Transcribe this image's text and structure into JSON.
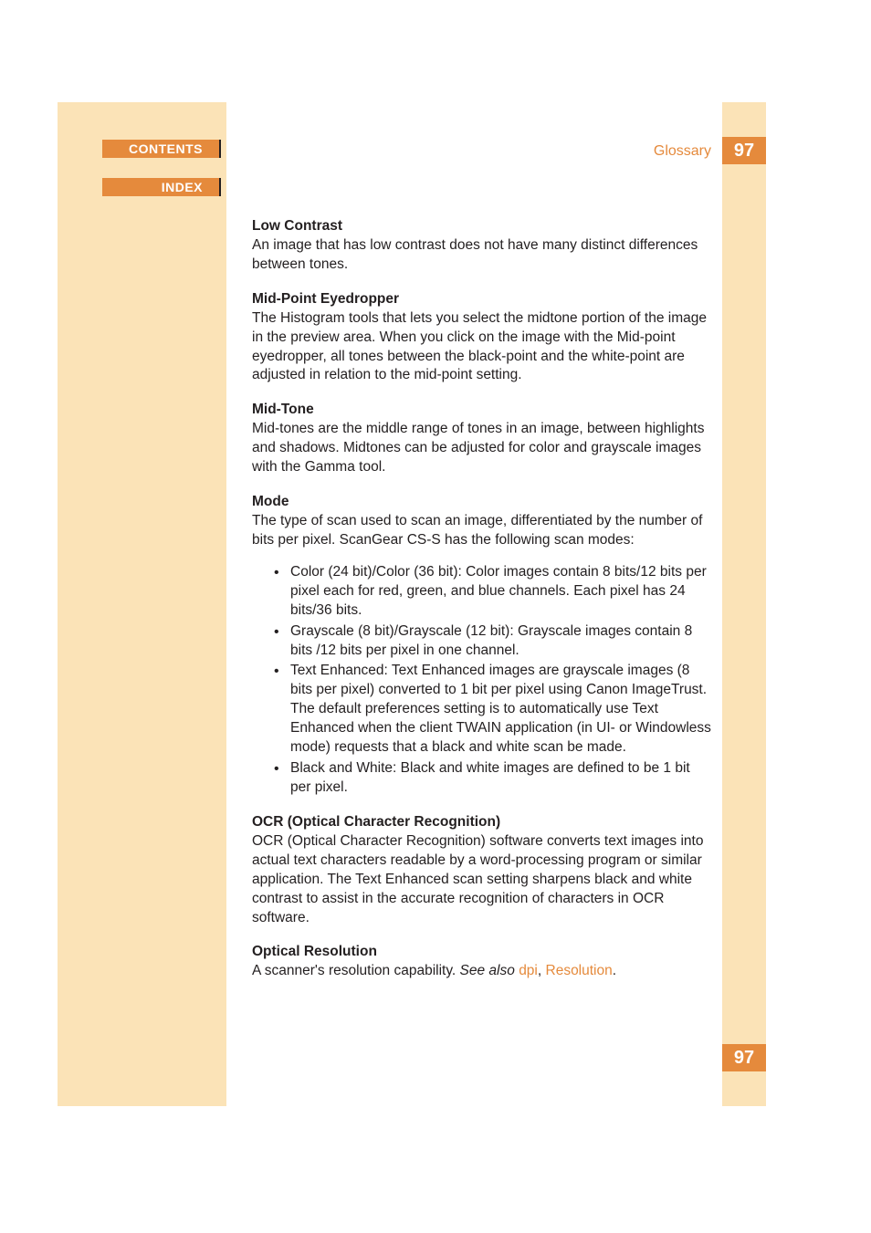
{
  "nav": {
    "contents_label": "CONTENTS",
    "index_label": "INDEX"
  },
  "header": {
    "section": "Glossary",
    "page_number": "97"
  },
  "entries": {
    "low_contrast": {
      "term": "Low Contrast",
      "def": "An image that has low contrast does not have many distinct differences between tones."
    },
    "mid_point_eyedropper": {
      "term": "Mid-Point Eyedropper",
      "def": "The Histogram tools that lets you select the midtone portion of the image in the preview area. When you click on the image with the Mid-point eyedropper, all tones between the black-point and the white-point are adjusted in relation to the mid-point setting."
    },
    "mid_tone": {
      "term": "Mid-Tone",
      "def": "Mid-tones are the middle range of tones in an image, between highlights and shadows. Midtones can be adjusted for color and grayscale images with the Gamma tool."
    },
    "mode": {
      "term": "Mode",
      "def": "The type of scan used to scan an image, differentiated by the number of bits per pixel. ScanGear CS-S has the following scan modes:",
      "items": [
        "Color (24 bit)/Color (36 bit):  Color images contain 8 bits/12 bits per pixel each for red, green, and blue channels. Each pixel has 24 bits/36 bits.",
        "Grayscale (8 bit)/Grayscale (12 bit): Grayscale images contain 8 bits /12 bits per pixel in one channel.",
        "Text Enhanced:  Text Enhanced images are grayscale images (8 bits per pixel) converted to 1 bit per pixel using Canon ImageTrust. The default preferences setting is to automatically use Text Enhanced when the client TWAIN application (in UI- or Windowless mode) requests that a black and white scan be made.",
        "Black and White:  Black and white images are defined to be 1 bit per pixel."
      ]
    },
    "ocr": {
      "term": "OCR (Optical Character Recognition)",
      "def": "OCR (Optical Character Recognition) software converts text images into actual text characters readable by a word-processing program or similar application. The Text Enhanced scan setting sharpens black and white contrast to assist in the accurate recognition of characters in OCR software."
    },
    "optical_resolution": {
      "term": "Optical Resolution",
      "def_prefix": "A scanner's resolution capability. ",
      "see_also_label": "See also ",
      "xref1": "dpi",
      "comma": ", ",
      "xref2": "Resolution",
      "period": "."
    }
  }
}
